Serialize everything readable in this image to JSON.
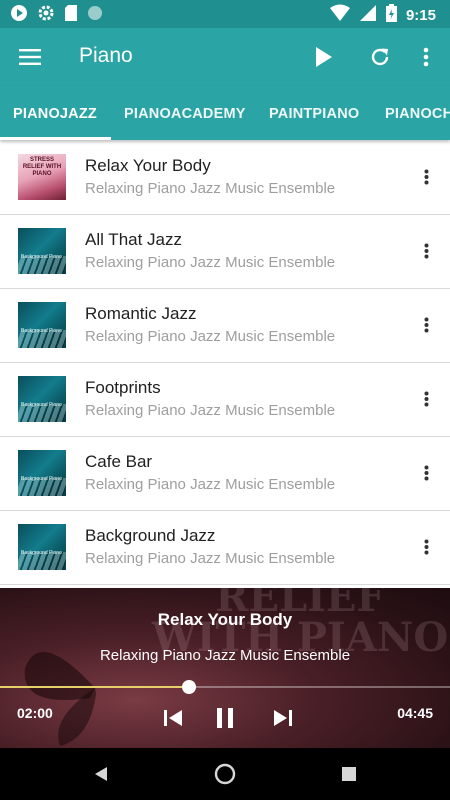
{
  "status_bar": {
    "time": "9:15",
    "left_icons": [
      "play-circle-icon",
      "gear-icon",
      "sd-card-icon",
      "circle-icon"
    ],
    "right_icons": [
      "wifi-icon",
      "signal-icon",
      "battery-icon"
    ]
  },
  "app_bar": {
    "title": "Piano",
    "actions": [
      "menu-icon",
      "play-icon",
      "refresh-icon",
      "more-vert-icon"
    ]
  },
  "tabs": [
    {
      "label": "PIANOJAZZ",
      "selected": true
    },
    {
      "label": "PIANOACADEMY",
      "selected": false
    },
    {
      "label": "PAINTPIANO",
      "selected": false
    },
    {
      "label": "PIANOCH",
      "selected": false
    }
  ],
  "tracks": [
    {
      "title": "Relax Your Body",
      "artist": "Relaxing Piano Jazz Music Ensemble",
      "thumb_text": "STRESS RELIEF WITH PIANO",
      "thumb": "pink"
    },
    {
      "title": "All That Jazz",
      "artist": "Relaxing Piano Jazz Music Ensemble",
      "thumb_text": "Background Piano",
      "thumb": "teal"
    },
    {
      "title": "Romantic Jazz",
      "artist": "Relaxing Piano Jazz Music Ensemble",
      "thumb_text": "Background Piano",
      "thumb": "teal"
    },
    {
      "title": "Footprints",
      "artist": "Relaxing Piano Jazz Music Ensemble",
      "thumb_text": "Background Piano",
      "thumb": "teal"
    },
    {
      "title": "Cafe Bar",
      "artist": "Relaxing Piano Jazz Music Ensemble",
      "thumb_text": "Background Piano",
      "thumb": "teal"
    },
    {
      "title": "Background Jazz",
      "artist": "Relaxing Piano Jazz Music Ensemble",
      "thumb_text": "Background Piano",
      "thumb": "teal"
    }
  ],
  "player": {
    "title": "Relax Your Body",
    "artist": "Relaxing Piano Jazz Music Ensemble",
    "art_text": "RELIEF WITH PIANO",
    "current_time": "02:00",
    "total_time": "04:45",
    "progress": 0.421,
    "controls": [
      "skip-previous-icon",
      "pause-icon",
      "skip-next-icon"
    ]
  },
  "nav_bar": {
    "buttons": [
      "back-icon",
      "home-icon",
      "recents-icon"
    ]
  },
  "colors": {
    "status_bar": "#1f8f8f",
    "app_bar": "#2aa4a4",
    "tab_indicator": "#ffffff",
    "seek_fill": "#e6d06a"
  }
}
